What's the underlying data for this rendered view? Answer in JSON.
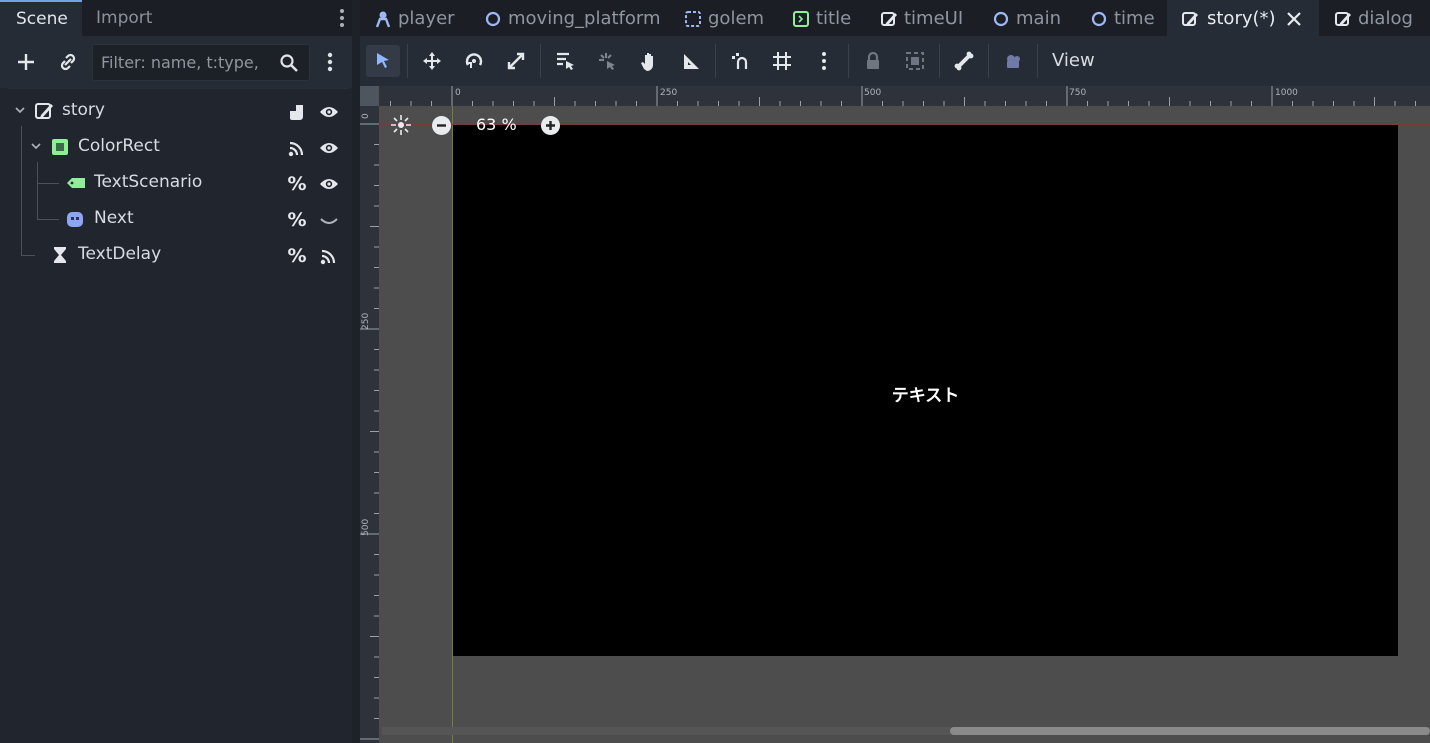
{
  "dock": {
    "tabs": [
      {
        "label": "Scene",
        "active": true
      },
      {
        "label": "Import",
        "active": false
      }
    ],
    "filter_placeholder": "Filter: name, t:type,",
    "tree": [
      {
        "label": "story",
        "icon": "control-node-icon",
        "depth": 0,
        "expanded": true,
        "right_icons": [
          "script-icon",
          "visibility-icon"
        ]
      },
      {
        "label": "ColorRect",
        "icon": "colorrect-icon",
        "depth": 1,
        "expanded": true,
        "right_icons": [
          "signal-icon",
          "visibility-icon"
        ]
      },
      {
        "label": "TextScenario",
        "icon": "label-icon",
        "depth": 2,
        "right_icons": [
          "unique-name-icon",
          "visibility-icon"
        ]
      },
      {
        "label": "Next",
        "icon": "texture-button-icon",
        "depth": 2,
        "right_icons": [
          "unique-name-icon",
          "hidden-icon"
        ]
      },
      {
        "label": "TextDelay",
        "icon": "timer-icon",
        "depth": 1,
        "right_icons": [
          "unique-name-icon",
          "signal-icon"
        ]
      }
    ],
    "percent_glyph": "%"
  },
  "scene_tabs": [
    {
      "label": "player",
      "icon": "character-icon",
      "active": false
    },
    {
      "label": "moving_platform",
      "icon": "node2d-icon",
      "active": false
    },
    {
      "label": "golem",
      "icon": "area-icon",
      "active": false
    },
    {
      "label": "title",
      "icon": "panel-icon",
      "active": false
    },
    {
      "label": "timeUI",
      "icon": "control-icon",
      "active": false
    },
    {
      "label": "main",
      "icon": "node2d-icon",
      "active": false
    },
    {
      "label": "time",
      "icon": "node2d-icon",
      "active": false
    },
    {
      "label": "story(*)",
      "icon": "control-icon",
      "active": true
    },
    {
      "label": "dialog",
      "icon": "control-icon",
      "active": false
    }
  ],
  "toolbar": {
    "view_label": "View",
    "tools": [
      "select-tool-icon",
      "move-tool-icon",
      "rotate-tool-icon",
      "scale-tool-icon",
      "list-select-icon",
      "pivot-icon",
      "pan-icon",
      "ruler-icon",
      "smart-snap-icon",
      "grid-snap-icon",
      "more-icon",
      "lock-icon",
      "group-icon",
      "bone-icon",
      "camera-override-icon"
    ]
  },
  "viewport": {
    "zoom_label": "63 %",
    "canvas_text": "テキスト",
    "ruler_h_labels": [
      "0",
      "250",
      "500",
      "750",
      "1000"
    ],
    "ruler_v_labels": [
      "0",
      "250",
      "500"
    ]
  }
}
